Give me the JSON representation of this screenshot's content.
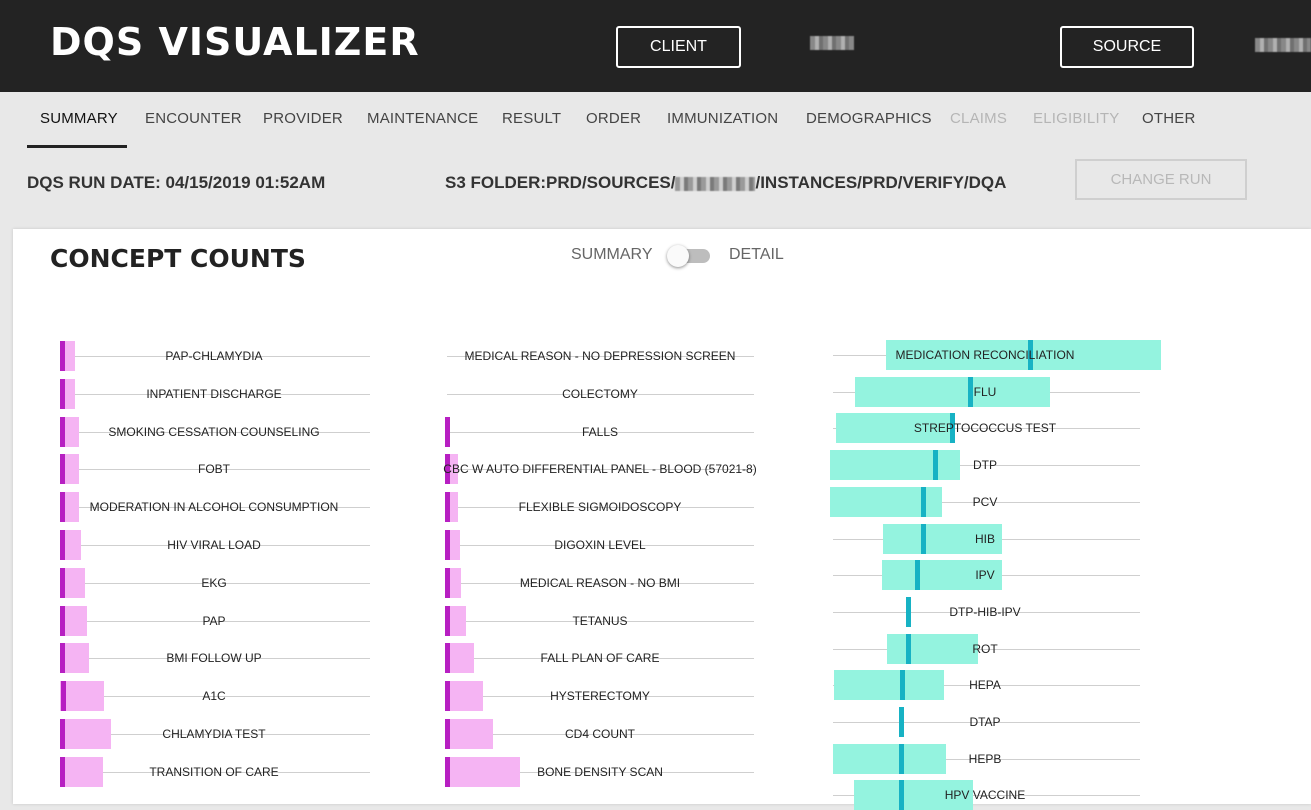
{
  "app": {
    "title": "DQS VISUALIZER"
  },
  "header": {
    "client_label": "CLIENT",
    "source_label": "SOURCE"
  },
  "tabs": [
    {
      "label": "SUMMARY",
      "state": "active"
    },
    {
      "label": "ENCOUNTER",
      "state": "normal"
    },
    {
      "label": "PROVIDER",
      "state": "normal"
    },
    {
      "label": "MAINTENANCE",
      "state": "normal"
    },
    {
      "label": "RESULT",
      "state": "normal"
    },
    {
      "label": "ORDER",
      "state": "normal"
    },
    {
      "label": "IMMUNIZATION",
      "state": "normal"
    },
    {
      "label": "DEMOGRAPHICS",
      "state": "normal"
    },
    {
      "label": "CLAIMS",
      "state": "disabled"
    },
    {
      "label": "ELIGIBILITY",
      "state": "disabled"
    },
    {
      "label": "OTHER",
      "state": "normal"
    }
  ],
  "run": {
    "date_text": "DQS RUN DATE: 04/15/2019 01:52AM",
    "s3_prefix": "S3 FOLDER:PRD/SOURCES/",
    "s3_suffix": "/INSTANCES/PRD/VERIFY/DQA",
    "change_run_label": "CHANGE RUN"
  },
  "card": {
    "title": "CONCEPT COUNTS",
    "toggle_left": "SUMMARY",
    "toggle_right": "DETAIL"
  },
  "colors": {
    "range_pink": "#f5b4f3",
    "mark_purple": "#b71fc2",
    "range_teal": "#94f3df",
    "mark_teal": "#17b2c4"
  },
  "chart_data": {
    "type": "range-bar",
    "columns": [
      {
        "labels": [
          "PAP-CHLAMYDIA",
          "INPATIENT DISCHARGE",
          "SMOKING CESSATION COUNSELING",
          "FOBT",
          "MODERATION IN ALCOHOL CONSUMPTION",
          "HIV VIRAL LOAD",
          "EKG",
          "PAP",
          "BMI FOLLOW UP",
          "A1C",
          "CHLAMYDIA TEST",
          "TRANSITION OF CARE"
        ]
      },
      {
        "labels": [
          "MEDICAL REASON - NO DEPRESSION SCREEN",
          "COLECTOMY",
          "FALLS",
          "CBC W AUTO DIFFERENTIAL PANEL - BLOOD (57021-8)",
          "FLEXIBLE SIGMOIDOSCOPY",
          "DIGOXIN LEVEL",
          "MEDICAL REASON - NO BMI",
          "TETANUS",
          "FALL PLAN OF CARE",
          "HYSTERECTOMY",
          "CD4 COUNT",
          "BONE DENSITY SCAN"
        ]
      },
      {
        "labels": [
          "MEDICATION RECONCILIATION",
          "FLU",
          "STREPTOCOCCUS TEST",
          "DTP",
          "PCV",
          "HIB",
          "IPV",
          "DTP-HIB-IPV",
          "ROT",
          "HEPA",
          "DTAP",
          "HEPB",
          "HPV VACCINE"
        ]
      }
    ]
  }
}
